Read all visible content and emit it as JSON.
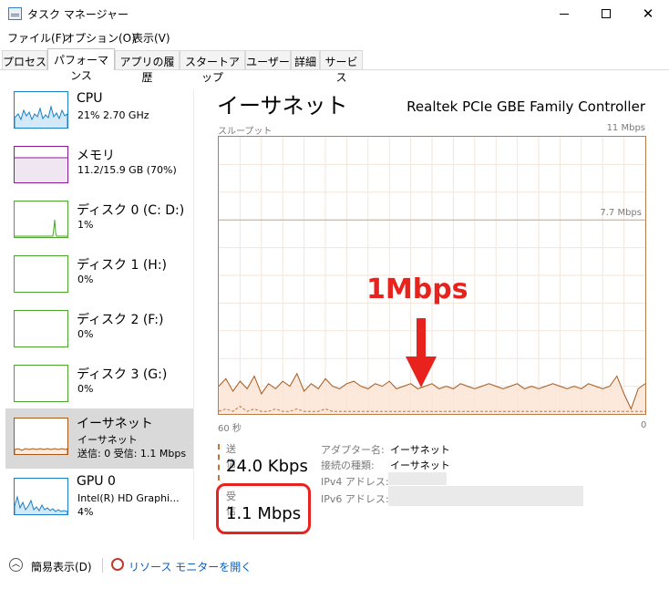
{
  "window": {
    "title": "タスク マネージャー"
  },
  "menu": [
    "ファイル(F)",
    "オプション(O)",
    "表示(V)"
  ],
  "tabs": [
    "プロセス",
    "パフォーマンス",
    "アプリの履歴",
    "スタートアップ",
    "ユーザー",
    "詳細",
    "サービス"
  ],
  "active_tab": "パフォーマンス",
  "sidebar": {
    "items": [
      {
        "name": "CPU",
        "sub": "21%  2.70 GHz",
        "sub2": "",
        "color": "#1a7fc6"
      },
      {
        "name": "メモリ",
        "sub": "11.2/15.9 GB (70%)",
        "sub2": "",
        "color": "#8b1a9b"
      },
      {
        "name": "ディスク 0 (C: D:)",
        "sub": "1%",
        "sub2": "",
        "color": "#4ca52c"
      },
      {
        "name": "ディスク 1 (H:)",
        "sub": "0%",
        "sub2": "",
        "color": "#4ca52c"
      },
      {
        "name": "ディスク 2 (F:)",
        "sub": "0%",
        "sub2": "",
        "color": "#4ca52c"
      },
      {
        "name": "ディスク 3 (G:)",
        "sub": "0%",
        "sub2": "",
        "color": "#4ca52c"
      },
      {
        "name": "イーサネット",
        "sub": "イーサネット",
        "sub2": "送信: 0 受信: 1.1 Mbps",
        "color": "#a7581b"
      },
      {
        "name": "GPU 0",
        "sub": "Intel(R) HD Graphi...",
        "sub2": "4%",
        "color": "#1a7fc6"
      }
    ],
    "active_index": 6
  },
  "main": {
    "title": "イーサネット",
    "device": "Realtek PCIe GBE Family Controller",
    "throughput_label": "スループット",
    "max_label": "11 Mbps",
    "mid_label": "7.7 Mbps",
    "time_label": "60 秒",
    "zero_label": "0",
    "annotation": "1Mbps"
  },
  "chart_data": {
    "type": "line",
    "title": "スループット",
    "ylim": [
      0,
      11
    ],
    "xlabel_left": "60 秒",
    "xlabel_right": "0",
    "y_unit": "Mbps",
    "series": [
      {
        "name": "受信",
        "values": [
          1.1,
          1.4,
          0.9,
          1.3,
          1.0,
          1.5,
          0.8,
          1.2,
          1.0,
          1.3,
          1.1,
          1.6,
          0.9,
          1.2,
          1.0,
          1.4,
          1.1,
          1.0,
          1.2,
          1.3,
          1.1,
          1.0,
          1.2,
          1.1,
          1.3,
          1.0,
          1.1,
          1.2,
          1.0,
          1.1,
          1.2,
          1.0,
          1.1,
          1.0,
          1.2,
          1.1,
          1.0,
          1.1,
          1.2,
          1.1,
          1.0,
          1.1,
          1.2,
          1.0,
          1.1,
          1.0,
          1.1,
          1.2,
          1.1,
          1.0,
          1.1,
          1.0,
          1.2,
          1.1,
          1.0,
          1.1,
          1.5,
          0.8,
          0.2,
          1.0,
          1.2
        ]
      },
      {
        "name": "送信",
        "values": [
          0.1,
          0.2,
          0.1,
          0.3,
          0.1,
          0.2,
          0.1,
          0.1,
          0.2,
          0.1,
          0.1,
          0.2,
          0.1,
          0.1,
          0.1,
          0.2,
          0.1,
          0.1,
          0.1,
          0.1,
          0.1,
          0.1,
          0.1,
          0.1,
          0.1,
          0.1,
          0.1,
          0.1,
          0.1,
          0.1,
          0.1,
          0.1,
          0.1,
          0.1,
          0.1,
          0.1,
          0.1,
          0.1,
          0.1,
          0.1,
          0.1,
          0.1,
          0.1,
          0.1,
          0.1,
          0.1,
          0.1,
          0.1,
          0.1,
          0.1,
          0.1,
          0.1,
          0.1,
          0.1,
          0.1,
          0.1,
          0.1,
          0.1,
          0.1,
          0.1,
          0.1
        ]
      }
    ],
    "grid": true
  },
  "stats": {
    "send_label": "送信",
    "send_value": "24.0 Kbps",
    "recv_label": "受信",
    "recv_value": "1.1 Mbps"
  },
  "info": {
    "adapter_key": "アダプター名:",
    "adapter_val": "イーサネット",
    "conn_key": "接続の種類:",
    "conn_val": "イーサネット",
    "ipv4_key": "IPv4 アドレス:",
    "ipv6_key": "IPv6 アドレス:"
  },
  "footer": {
    "less": "簡易表示(D)",
    "resmon": "リソース モニターを開く"
  }
}
